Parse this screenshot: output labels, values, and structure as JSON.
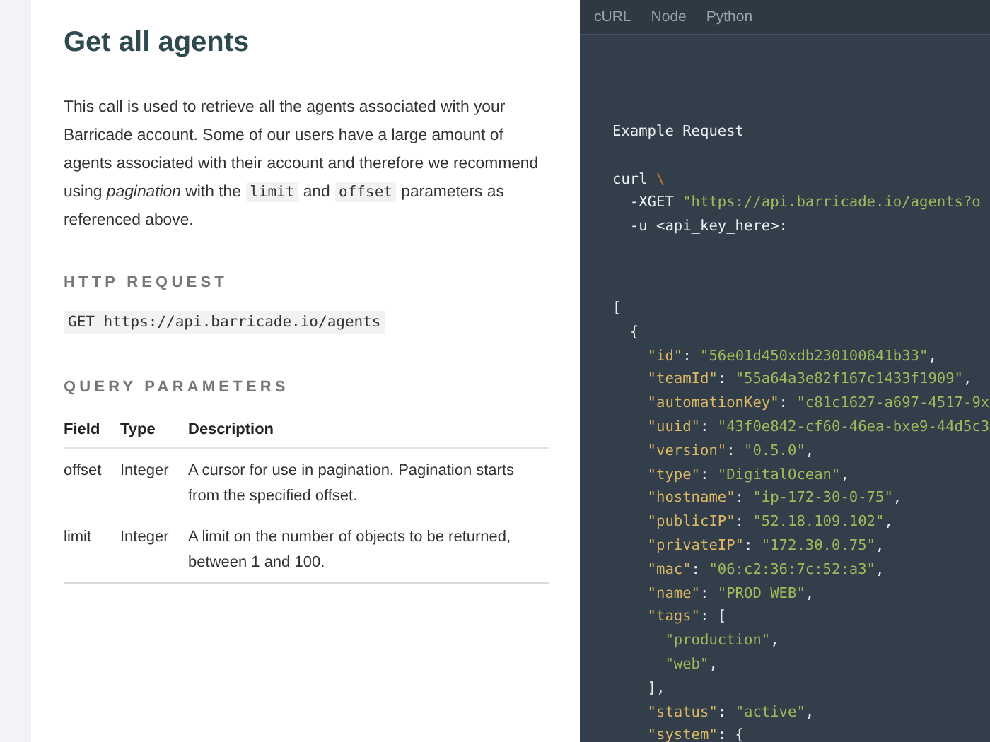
{
  "doc": {
    "title": "Get all agents",
    "intro": [
      {
        "kind": "text",
        "text": "This call is used to retrieve all the agents associated with your Barricade account. Some of our users have a large amount of agents associated with their account and therefore we recommend using "
      },
      {
        "kind": "em",
        "text": "pagination"
      },
      {
        "kind": "text",
        "text": " with the "
      },
      {
        "kind": "code",
        "text": "limit"
      },
      {
        "kind": "text",
        "text": " and "
      },
      {
        "kind": "code",
        "text": "offset"
      },
      {
        "kind": "text",
        "text": " parameters as referenced above."
      }
    ],
    "http_request": {
      "heading": "HTTP REQUEST",
      "endpoint": "GET https://api.barricade.io/agents"
    },
    "query_parameters": {
      "heading": "QUERY PARAMETERS",
      "columns": [
        "Field",
        "Type",
        "Description"
      ],
      "rows": [
        [
          "offset",
          "Integer",
          "A cursor for use in pagination. Pagination starts from the specified offset."
        ],
        [
          "limit",
          "Integer",
          "A limit on the number of objects to be returned, between 1 and 100."
        ]
      ]
    }
  },
  "code_panel": {
    "tabs": [
      "cURL",
      "Node",
      "Python"
    ],
    "request_title": "Example Request",
    "request_lines": [
      [
        {
          "kind": "plain",
          "text": "curl "
        },
        {
          "kind": "escape",
          "text": "\\"
        }
      ],
      [
        {
          "kind": "plain",
          "text": "  -XGET "
        },
        {
          "kind": "string",
          "text": "\"https://api.barricade.io/agents?o"
        }
      ],
      [
        {
          "kind": "plain",
          "text": "  -u <api_key_here>:"
        }
      ]
    ],
    "response_lines": [
      [
        {
          "kind": "plain",
          "text": "["
        }
      ],
      [
        {
          "kind": "plain",
          "text": "  {"
        }
      ],
      [
        {
          "kind": "key",
          "text": "    \"id\""
        },
        {
          "kind": "plain",
          "text": ": "
        },
        {
          "kind": "string",
          "text": "\"56e01d450xdb230100841b33\""
        },
        {
          "kind": "plain",
          "text": ","
        }
      ],
      [
        {
          "kind": "key",
          "text": "    \"teamId\""
        },
        {
          "kind": "plain",
          "text": ": "
        },
        {
          "kind": "string",
          "text": "\"55a64a3e82f167c1433f1909\""
        },
        {
          "kind": "plain",
          "text": ","
        }
      ],
      [
        {
          "kind": "key",
          "text": "    \"automationKey\""
        },
        {
          "kind": "plain",
          "text": ": "
        },
        {
          "kind": "string",
          "text": "\"c81c1627-a697-4517-9x"
        }
      ],
      [
        {
          "kind": "key",
          "text": "    \"uuid\""
        },
        {
          "kind": "plain",
          "text": ": "
        },
        {
          "kind": "string",
          "text": "\"43f0e842-cf60-46ea-bxe9-44d5c3"
        }
      ],
      [
        {
          "kind": "key",
          "text": "    \"version\""
        },
        {
          "kind": "plain",
          "text": ": "
        },
        {
          "kind": "string",
          "text": "\"0.5.0\""
        },
        {
          "kind": "plain",
          "text": ","
        }
      ],
      [
        {
          "kind": "key",
          "text": "    \"type\""
        },
        {
          "kind": "plain",
          "text": ": "
        },
        {
          "kind": "string",
          "text": "\"DigitalOcean\""
        },
        {
          "kind": "plain",
          "text": ","
        }
      ],
      [
        {
          "kind": "key",
          "text": "    \"hostname\""
        },
        {
          "kind": "plain",
          "text": ": "
        },
        {
          "kind": "string",
          "text": "\"ip-172-30-0-75\""
        },
        {
          "kind": "plain",
          "text": ","
        }
      ],
      [
        {
          "kind": "key",
          "text": "    \"publicIP\""
        },
        {
          "kind": "plain",
          "text": ": "
        },
        {
          "kind": "string",
          "text": "\"52.18.109.102\""
        },
        {
          "kind": "plain",
          "text": ","
        }
      ],
      [
        {
          "kind": "key",
          "text": "    \"privateIP\""
        },
        {
          "kind": "plain",
          "text": ": "
        },
        {
          "kind": "string",
          "text": "\"172.30.0.75\""
        },
        {
          "kind": "plain",
          "text": ","
        }
      ],
      [
        {
          "kind": "key",
          "text": "    \"mac\""
        },
        {
          "kind": "plain",
          "text": ": "
        },
        {
          "kind": "string",
          "text": "\"06:c2:36:7c:52:a3\""
        },
        {
          "kind": "plain",
          "text": ","
        }
      ],
      [
        {
          "kind": "key",
          "text": "    \"name\""
        },
        {
          "kind": "plain",
          "text": ": "
        },
        {
          "kind": "string",
          "text": "\"PROD_WEB\""
        },
        {
          "kind": "plain",
          "text": ","
        }
      ],
      [
        {
          "kind": "key",
          "text": "    \"tags\""
        },
        {
          "kind": "plain",
          "text": ": ["
        }
      ],
      [
        {
          "kind": "string",
          "text": "      \"production\""
        },
        {
          "kind": "plain",
          "text": ","
        }
      ],
      [
        {
          "kind": "string",
          "text": "      \"web\""
        },
        {
          "kind": "plain",
          "text": ","
        }
      ],
      [
        {
          "kind": "plain",
          "text": "    ],"
        }
      ],
      [
        {
          "kind": "key",
          "text": "    \"status\""
        },
        {
          "kind": "plain",
          "text": ": "
        },
        {
          "kind": "string",
          "text": "\"active\""
        },
        {
          "kind": "plain",
          "text": ","
        }
      ],
      [
        {
          "kind": "key",
          "text": "    \"system\""
        },
        {
          "kind": "plain",
          "text": ": {"
        }
      ]
    ]
  }
}
